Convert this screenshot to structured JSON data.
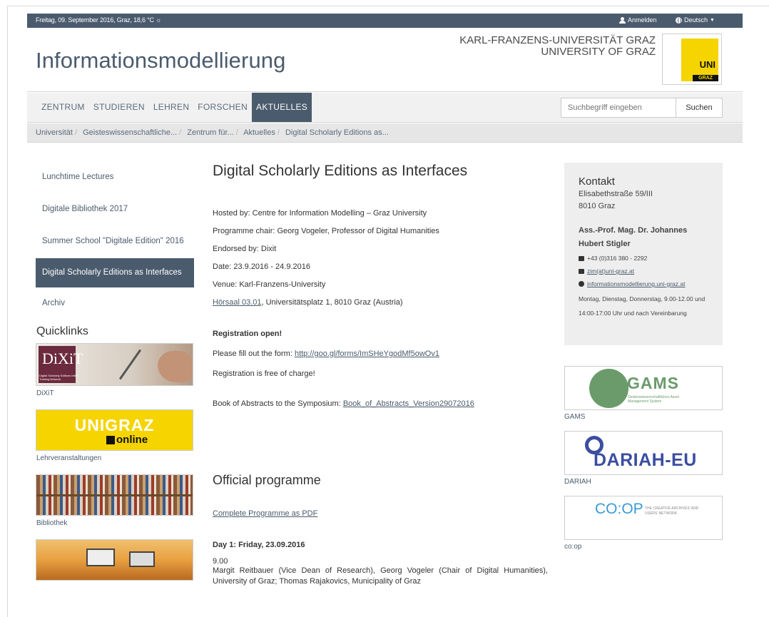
{
  "topbar": {
    "date_weather": "Freitag, 09. September 2016, Graz, 18,6 °C ☼",
    "login": "Anmelden",
    "language": "Deutsch"
  },
  "header": {
    "site_title": "Informationsmodellierung",
    "uni_name_de": "KARL-FRANZENS-UNIVERSITÄT GRAZ",
    "uni_name_en": "UNIVERSITY OF GRAZ",
    "logo_text_uni": "UNI",
    "logo_text_graz": "GRAZ"
  },
  "nav": {
    "items": [
      {
        "label": "ZENTRUM"
      },
      {
        "label": "STUDIEREN"
      },
      {
        "label": "LEHREN"
      },
      {
        "label": "FORSCHEN"
      },
      {
        "label": "AKTUELLES"
      }
    ],
    "search_placeholder": "Suchbegriff eingeben",
    "search_button": "Suchen"
  },
  "breadcrumb": [
    "Universität",
    "Geisteswissenschaftliche...",
    "Zentrum für...",
    "Aktuelles",
    "Digital Scholarly Editions as..."
  ],
  "sidebar": {
    "items": [
      {
        "label": "Lunchtime Lectures"
      },
      {
        "label": "Digitale Bibliothek 2017"
      },
      {
        "label": "Summer School \"Digitale Edition\" 2016"
      },
      {
        "label": "Digital Scholarly Editions as Interfaces"
      },
      {
        "label": "Archiv"
      }
    ],
    "quicklinks_title": "Quicklinks",
    "quicklinks": [
      {
        "label": "DiXiT",
        "img_text": "DiXiT",
        "img_subtext": "Digital Scholarly Editions Initial Training Network"
      },
      {
        "label": "Lehrveranstaltungen",
        "img_text": "UNIGRAZ",
        "img_subtext": "online"
      },
      {
        "label": "Bibliothek"
      },
      {
        "label": ""
      }
    ]
  },
  "main": {
    "title": "Digital Scholarly Editions as Interfaces",
    "hosted": "Hosted by: Centre for Information Modelling – Graz University",
    "chair": "Programme chair: Georg Vogeler, Professor of Digital Humanities",
    "endorsed": "Endorsed by: Dixit",
    "date": "Date: 23.9.2016 - 24.9.2016",
    "venue": "Venue: Karl-Franzens-University",
    "room_link": "Hörsaal 03.01",
    "room_rest": ", Universitätsplatz 1, 8010 Graz (Austria)",
    "reg_open": "Registration open!",
    "reg_form_prefix": "Please fill out the form: ",
    "reg_form_link": "http://goo.gl/forms/ImSHeYgodMf5owOv1",
    "reg_free": "Registration is free of charge!",
    "abstracts_prefix": "Book of Abstracts to the Symposium: ",
    "abstracts_link": "Book_of_Abstracts_Version29072016",
    "programme_title": "Official programme",
    "programme_pdf": "Complete Programme as PDF",
    "day1": "Day 1: Friday, 23.09.2016",
    "time1": "9.00",
    "item1": "Margit Reitbauer (Vice Dean of Research), Georg Vogeler (Chair of Digital Humanities), University of Graz; Thomas Rajakovics, Municipality of Graz"
  },
  "contact": {
    "title": "Kontakt",
    "street": "Elisabethstraße 59/III",
    "city": "8010 Graz",
    "person": "Ass.-Prof. Mag. Dr. Johannes Hubert Stigler",
    "phone": "+43 (0)316 380 - 2292",
    "email": "zim(at)uni-graz.at",
    "web": "informationsmodellierung.uni-graz.at",
    "hours": "Montag, Dienstag, Donnerstag, 9.00-12.00 und 14:00-17:00 Uhr und nach Vereinbarung"
  },
  "partners": [
    {
      "label": "GAMS",
      "logo_text": "GAMS",
      "logo_subtext": "Geisteswissenschaftliches Asset Management System"
    },
    {
      "label": "DARIAH",
      "logo_text": "DARIAH-EU"
    },
    {
      "label": "co:op",
      "logo_text": "CO:OP",
      "logo_subtext": "THE CREATIVE ARCHIVES' AND USERS' NETWORK"
    }
  ],
  "colors": {
    "brand_dark": "#4a5b6d",
    "uni_yellow": "#f5d400",
    "gams_green": "#6b9b6b",
    "dariah_blue": "#3b4ea0",
    "coop_blue": "#3a9ad9"
  }
}
